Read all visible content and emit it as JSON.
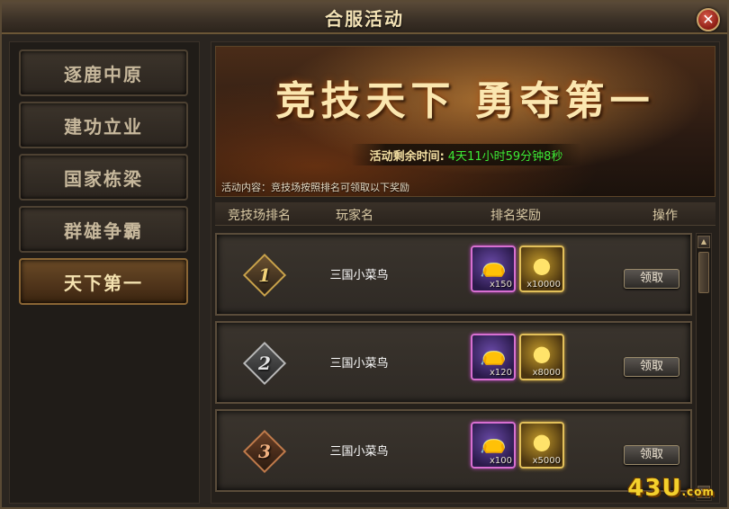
{
  "window": {
    "title": "合服活动",
    "close_label": "✕"
  },
  "sidebar": {
    "items": [
      {
        "label": "逐鹿中原",
        "active": false
      },
      {
        "label": "建功立业",
        "active": false
      },
      {
        "label": "国家栋梁",
        "active": false
      },
      {
        "label": "群雄争霸",
        "active": false
      },
      {
        "label": "天下第一",
        "active": true
      }
    ]
  },
  "banner": {
    "slogan": "竞技天下 勇夺第一",
    "countdown_label": "活动剩余时间:",
    "countdown_value": "4天11小时59分钟8秒",
    "activity_desc": "活动内容：竞技场按照排名可领取以下奖励"
  },
  "table": {
    "headers": [
      "竞技场排名",
      "玩家名",
      "排名奖励",
      "操作"
    ],
    "rows": [
      {
        "rank": "1",
        "player": "三国小菜鸟",
        "rewards": [
          {
            "icon": "blue-bag-icon",
            "count": "x150"
          },
          {
            "icon": "gold-ingot-icon",
            "count": "x10000"
          }
        ],
        "action": "领取"
      },
      {
        "rank": "2",
        "player": "三国小菜鸟",
        "rewards": [
          {
            "icon": "blue-bag-icon",
            "count": "x120"
          },
          {
            "icon": "gold-ingot-icon",
            "count": "x8000"
          }
        ],
        "action": "领取"
      },
      {
        "rank": "3",
        "player": "三国小菜鸟",
        "rewards": [
          {
            "icon": "blue-bag-icon",
            "count": "x100"
          },
          {
            "icon": "gold-ingot-icon",
            "count": "x5000"
          }
        ],
        "action": "领取"
      }
    ]
  },
  "watermark": {
    "text": "43U",
    "suffix": ".com"
  },
  "colors": {
    "countdown": "#3dea35",
    "title": "#f3e2b5",
    "accent_gold": "#e2c05a",
    "accent_purple": "#d86fd1"
  }
}
